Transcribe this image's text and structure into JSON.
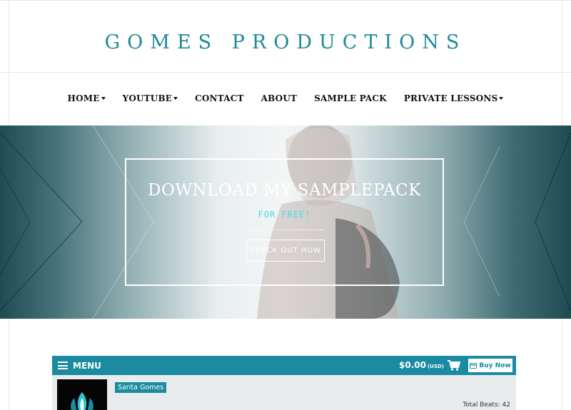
{
  "site": {
    "title": "GOMES PRODUCTIONS"
  },
  "nav": {
    "items": [
      {
        "label": "HOME",
        "dropdown": true
      },
      {
        "label": "YOUTUBE",
        "dropdown": true
      },
      {
        "label": "CONTACT",
        "dropdown": false
      },
      {
        "label": "ABOUT",
        "dropdown": false
      },
      {
        "label": "SAMPLE PACK",
        "dropdown": false
      },
      {
        "label": "PRIVATE LESSONS",
        "dropdown": true
      }
    ]
  },
  "hero": {
    "title": "DOWNLOAD MY SAMPLEPACK",
    "subtitle": "FOR FREE!",
    "button_label": "CHECK OUT HOW"
  },
  "player": {
    "menu_label": "MENU",
    "price": "$0.00",
    "currency": "(USD)",
    "buy_label": "Buy Now",
    "artist": "Sarita Gomes",
    "total_beats_label": "Total Beats: 42"
  },
  "icons": {
    "menu": "hamburger-icon",
    "cart": "cart-icon",
    "card": "credit-card-icon",
    "caret": "caret-down-icon"
  },
  "colors": {
    "accent": "#1a8ba0",
    "title": "#1d8a99",
    "hero_subtitle": "#3fe0e6"
  }
}
